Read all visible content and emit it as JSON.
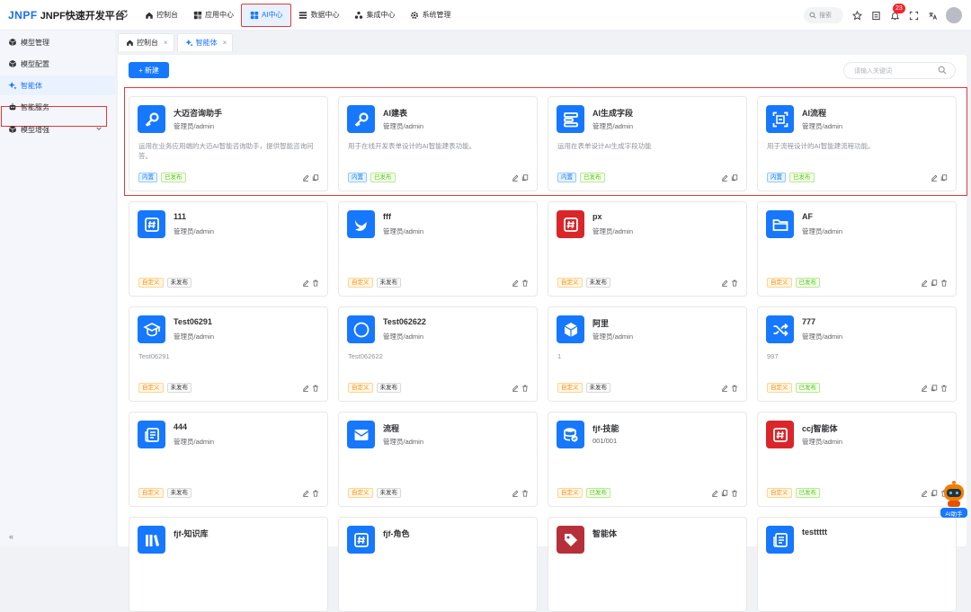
{
  "app": {
    "logo": "JNPF",
    "title": "JNPF快速开发平台"
  },
  "nav": [
    {
      "label": "控制台",
      "icon": "home-icon"
    },
    {
      "label": "应用中心",
      "icon": "apps-icon"
    },
    {
      "label": "AI中心",
      "icon": "grid-icon",
      "active": true
    },
    {
      "label": "数据中心",
      "icon": "list-icon"
    },
    {
      "label": "集成中心",
      "icon": "integration-icon"
    },
    {
      "label": "系统管理",
      "icon": "gear-icon"
    }
  ],
  "topbar": {
    "search_label": "搜索",
    "notifications": "23"
  },
  "sidebar": {
    "items": [
      {
        "label": "模型管理",
        "icon": "cube-icon"
      },
      {
        "label": "模型配置",
        "icon": "cube-icon"
      },
      {
        "label": "智能体",
        "icon": "sparkle-icon",
        "active": true
      },
      {
        "label": "智能服务",
        "icon": "robot-icon"
      },
      {
        "label": "模型增强",
        "icon": "cube-icon",
        "expandable": true
      }
    ],
    "collapse": "«"
  },
  "tabs": [
    {
      "label": "控制台",
      "icon": "home-icon"
    },
    {
      "label": "智能体",
      "icon": "sparkle-icon",
      "active": true
    }
  ],
  "toolbar": {
    "new_label": "新建",
    "search_placeholder": "请输入关键词"
  },
  "cards": [
    {
      "name": "大迈咨询助手",
      "creator": "管理员/admin",
      "desc": "运用在业务应用端的大迈AI智能咨询助手，提供智能咨询问答。",
      "tags": [
        "内置",
        "已发布"
      ],
      "icon": "key-icon",
      "color": "#1677ff"
    },
    {
      "name": "AI建表",
      "creator": "管理员/admin",
      "desc": "用于在线开发表单设计的AI智能建表功能。",
      "tags": [
        "内置",
        "已发布"
      ],
      "icon": "key-icon",
      "color": "#1677ff"
    },
    {
      "name": "AI生成字段",
      "creator": "管理员/admin",
      "desc": "运用在表单设计AI生成字段功能",
      "tags": [
        "内置",
        "已发布"
      ],
      "icon": "fields-icon",
      "color": "#1677ff"
    },
    {
      "name": "AI流程",
      "creator": "管理员/admin",
      "desc": "用于流程设计的AI智能建流程功能。",
      "tags": [
        "内置",
        "已发布"
      ],
      "icon": "scan-icon",
      "color": "#1677ff"
    },
    {
      "name": "111",
      "creator": "管理员/admin",
      "desc": "",
      "tags": [
        "自定义",
        "未发布"
      ],
      "icon": "hash-icon",
      "color": "#1677ff"
    },
    {
      "name": "fff",
      "creator": "管理员/admin",
      "desc": "",
      "tags": [
        "自定义",
        "未发布"
      ],
      "icon": "bird-icon",
      "color": "#1677ff"
    },
    {
      "name": "px",
      "creator": "管理员/admin",
      "desc": "",
      "tags": [
        "自定义",
        "未发布"
      ],
      "icon": "hash-icon",
      "color": "#d9262a"
    },
    {
      "name": "AF",
      "creator": "管理员/admin",
      "desc": "",
      "tags": [
        "自定义",
        "已发布"
      ],
      "icon": "folder-icon",
      "color": "#1677ff"
    },
    {
      "name": "Test06291",
      "creator": "管理员/admin",
      "desc": "Test06291",
      "tags": [
        "自定义",
        "未发布"
      ],
      "icon": "graduation-icon",
      "color": "#1677ff"
    },
    {
      "name": "Test062622",
      "creator": "管理员/admin",
      "desc": "Test062622",
      "tags": [
        "自定义",
        "未发布"
      ],
      "icon": "circle-icon",
      "color": "#1677ff"
    },
    {
      "name": "阿里",
      "creator": "管理员/admin",
      "desc": "1",
      "tags": [
        "自定义",
        "未发布"
      ],
      "icon": "box-icon",
      "color": "#1677ff"
    },
    {
      "name": "777",
      "creator": "管理员/admin",
      "desc": "997",
      "tags": [
        "自定义",
        "已发布"
      ],
      "icon": "shuffle-icon",
      "color": "#1677ff"
    },
    {
      "name": "444",
      "creator": "管理员/admin",
      "desc": "",
      "tags": [
        "自定义",
        "未发布"
      ],
      "icon": "news-icon",
      "color": "#1677ff"
    },
    {
      "name": "流程",
      "creator": "管理员/admin",
      "desc": "",
      "tags": [
        "自定义",
        "未发布"
      ],
      "icon": "mail-icon",
      "color": "#1677ff"
    },
    {
      "name": "fjf-技能",
      "creator": "001/001",
      "desc": "",
      "tags": [
        "自定义",
        "已发布"
      ],
      "icon": "database-icon",
      "color": "#1677ff"
    },
    {
      "name": "ccj智能体",
      "creator": "管理员/admin",
      "desc": "",
      "tags": [
        "自定义",
        "已发布"
      ],
      "icon": "hash-icon",
      "color": "#d9262a"
    },
    {
      "name": "fjf-知识库",
      "creator": "",
      "desc": "",
      "tags": [],
      "icon": "books-icon",
      "color": "#1677ff"
    },
    {
      "name": "fjf-角色",
      "creator": "",
      "desc": "",
      "tags": [],
      "icon": "hash-icon",
      "color": "#1677ff"
    },
    {
      "name": "智能体",
      "creator": "",
      "desc": "",
      "tags": [],
      "icon": "tag-icon",
      "color": "#b5303a"
    },
    {
      "name": "testtttt",
      "creator": "",
      "desc": "",
      "tags": [],
      "icon": "news-icon",
      "color": "#1677ff"
    }
  ],
  "ai_assistant": {
    "label": "AI助手"
  }
}
